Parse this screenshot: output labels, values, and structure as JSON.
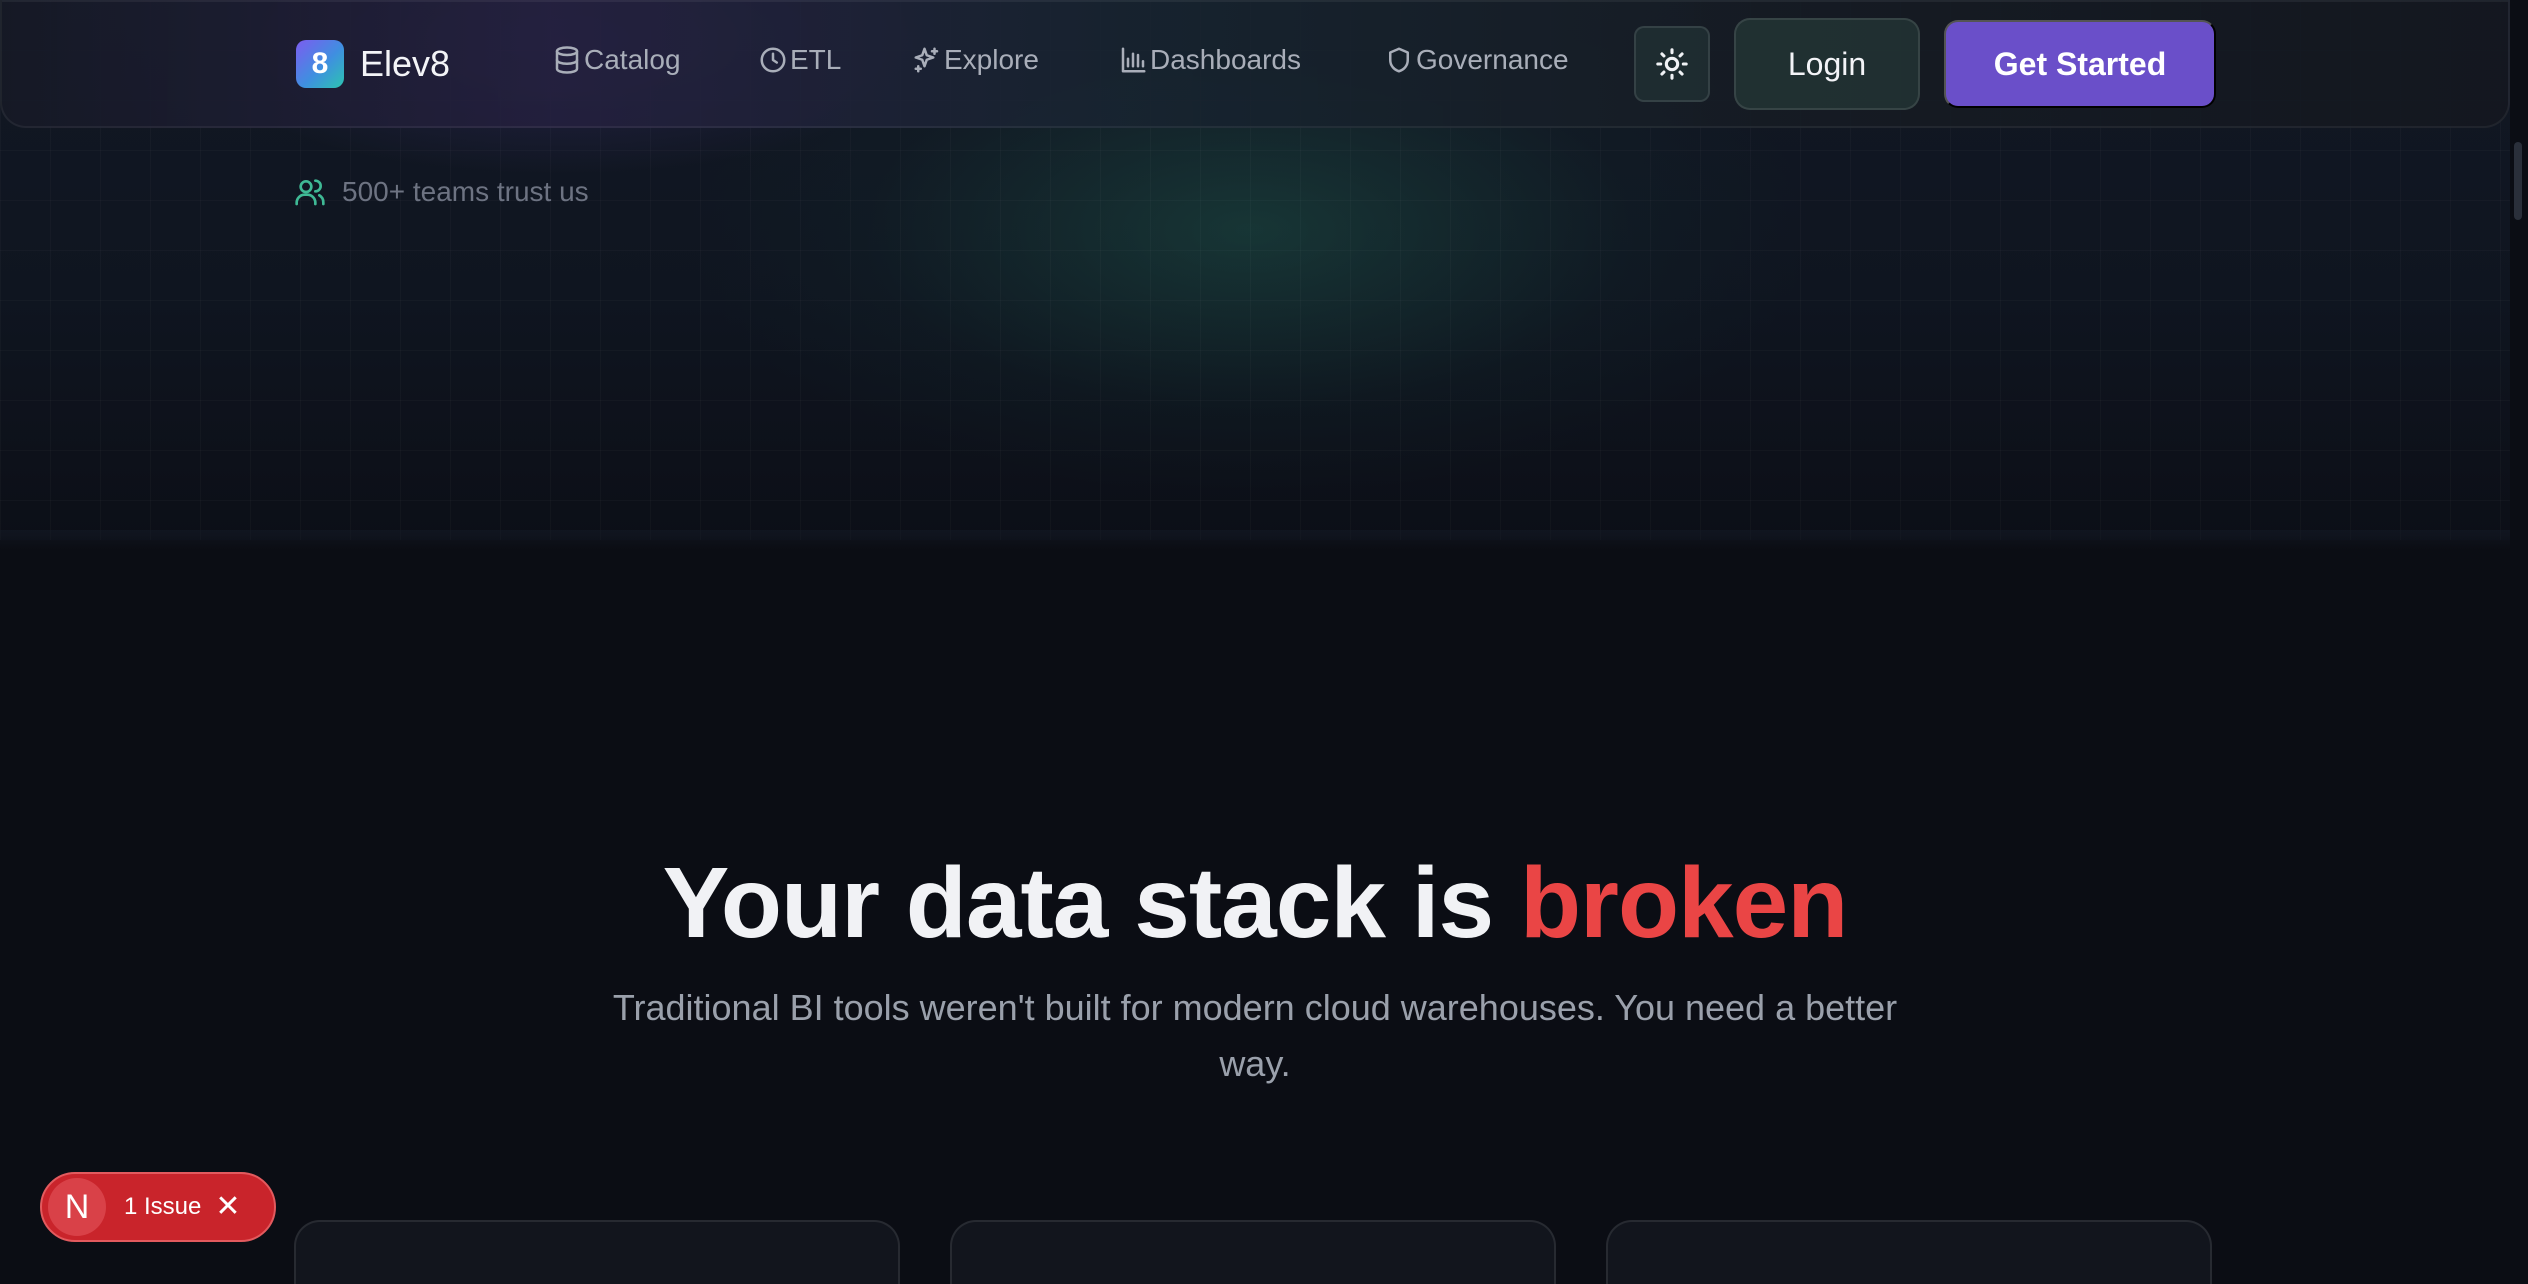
{
  "brand": {
    "name": "Elev8",
    "logo_glyph": "8",
    "logo_icon": "elev8-logo-icon"
  },
  "nav": {
    "items": [
      {
        "label": "Catalog",
        "icon": "database-icon"
      },
      {
        "label": "ETL",
        "icon": "clock-icon"
      },
      {
        "label": "Explore",
        "icon": "sparkles-icon"
      },
      {
        "label": "Dashboards",
        "icon": "bar-chart-icon"
      },
      {
        "label": "Governance",
        "icon": "shield-icon"
      }
    ],
    "theme_toggle_icon": "sun-icon",
    "login_label": "Login",
    "cta_label": "Get Started"
  },
  "hero": {
    "trust_text": "500+ teams trust us",
    "trust_icon": "users-icon",
    "headline_prefix": "Your data stack is ",
    "headline_accent": "broken",
    "subheadline": "Traditional BI tools weren't built for modern cloud warehouses. You need a better way."
  },
  "issues_badge": {
    "logo": "N",
    "label": "1 Issue",
    "close_icon": "close-icon"
  },
  "colors": {
    "background": "#0b0d14",
    "accent_purple": "#6a4fc9",
    "accent_red": "#ea4545",
    "accent_green": "#3fb995",
    "issue_red": "#c9242b"
  }
}
